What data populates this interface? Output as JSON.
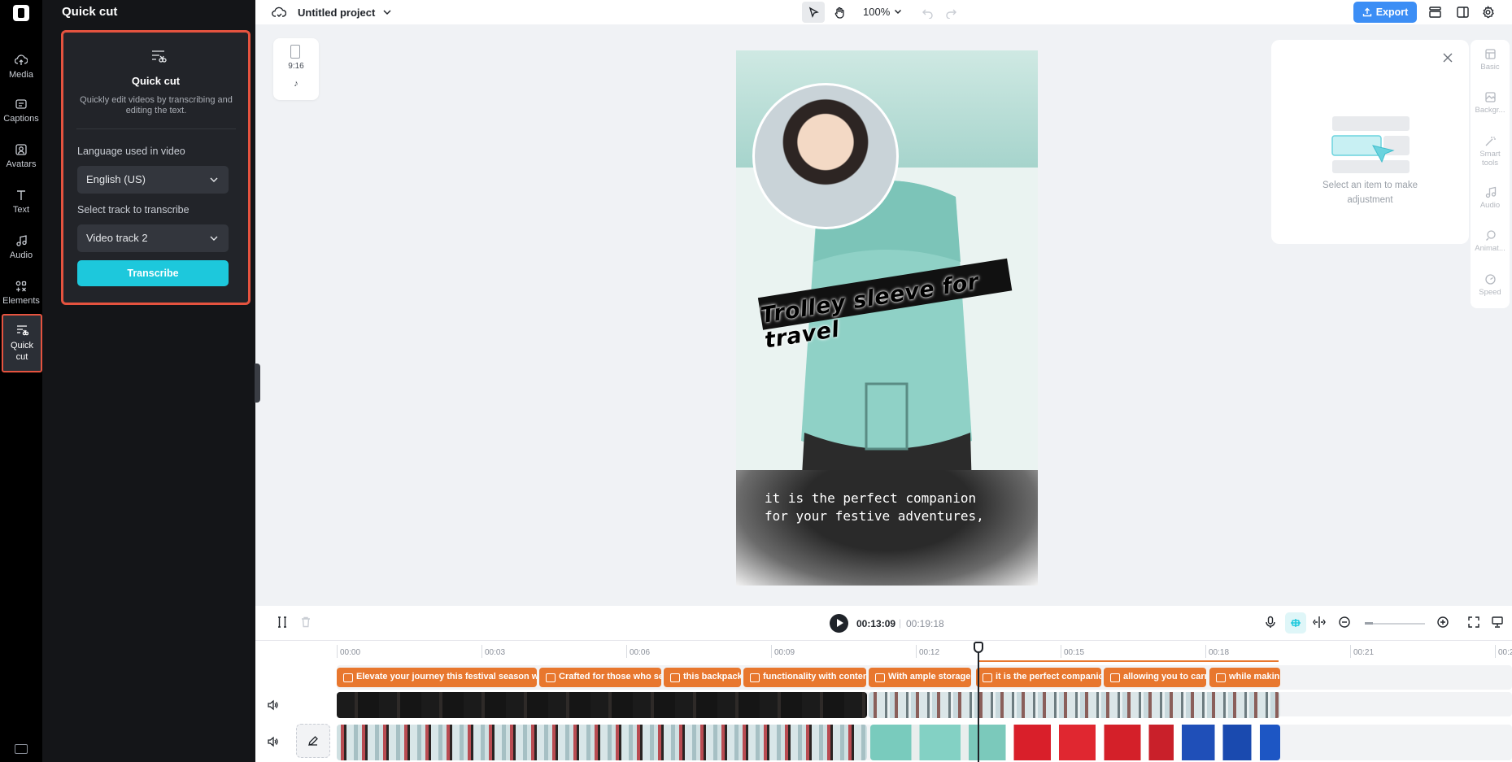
{
  "rail": {
    "items": [
      {
        "id": "media",
        "label": "Media",
        "icon": "cloud-upload-icon"
      },
      {
        "id": "captions",
        "label": "Captions",
        "icon": "captions-icon"
      },
      {
        "id": "avatars",
        "label": "Avatars",
        "icon": "avatar-icon"
      },
      {
        "id": "text",
        "label": "Text",
        "icon": "text-icon"
      },
      {
        "id": "audio",
        "label": "Audio",
        "icon": "music-note-icon"
      },
      {
        "id": "elements",
        "label": "Elements",
        "icon": "elements-icon"
      },
      {
        "id": "quickcut",
        "label": "Quick\ncut",
        "icon": "quick-cut-icon"
      }
    ]
  },
  "panel": {
    "title": "Quick cut",
    "card_title": "Quick cut",
    "card_desc": "Quickly edit videos by transcribing and editing the text.",
    "language_label": "Language used in video",
    "language_value": "English (US)",
    "track_label": "Select track to transcribe",
    "track_value": "Video track 2",
    "transcribe_label": "Transcribe"
  },
  "topbar": {
    "project_title": "Untitled project",
    "zoom": "100%",
    "export_label": "Export"
  },
  "format": {
    "ratio": "9:16"
  },
  "preview": {
    "banner_text": "Trolley sleeve for travel",
    "caption": "it is the perfect companion\nfor your festive adventures,"
  },
  "properties": {
    "empty_text": "Select an item to make adjustment",
    "tabs": [
      {
        "label": "Basic",
        "icon": "basic-icon"
      },
      {
        "label": "Backgr...",
        "icon": "background-icon"
      },
      {
        "label": "Smart tools",
        "icon": "magic-wand-icon"
      },
      {
        "label": "Audio",
        "icon": "music-note-icon"
      },
      {
        "label": "Animat...",
        "icon": "animation-icon"
      },
      {
        "label": "Speed",
        "icon": "speed-icon"
      }
    ]
  },
  "timeline": {
    "current_time": "00:13:09",
    "separator": "|",
    "total_time": "00:19:18",
    "ruler": [
      "00:00",
      "00:03",
      "00:06",
      "00:09",
      "00:12",
      "00:15",
      "00:18",
      "00:21",
      "00:2"
    ],
    "captions": [
      "Elevate your journey this festival season wit",
      "Crafted for those who se",
      "this backpack",
      "functionality with conten",
      "With ample storage",
      "it is the perfect companio",
      "allowing you to carr",
      "while makin"
    ]
  }
}
